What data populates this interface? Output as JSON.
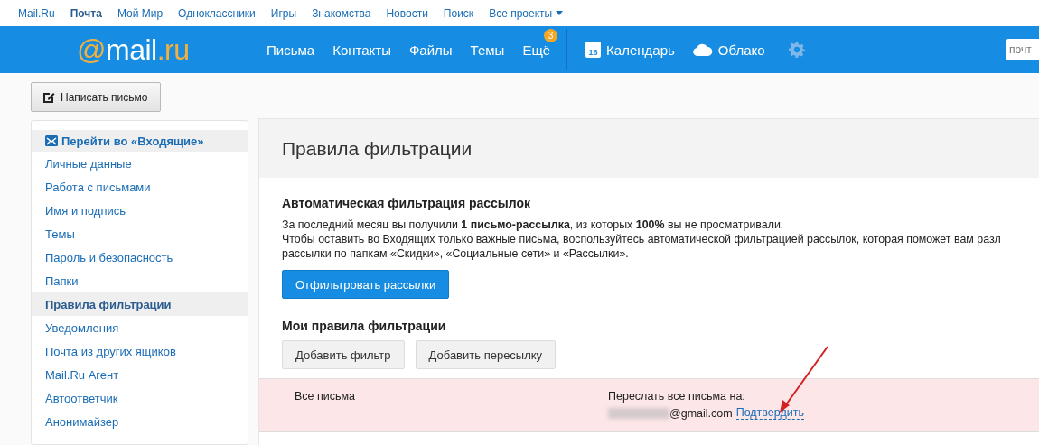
{
  "top_links": [
    {
      "label": "Mail.Ru",
      "selected": false
    },
    {
      "label": "Почта",
      "selected": true
    },
    {
      "label": "Мой Мир",
      "selected": false
    },
    {
      "label": "Одноклассники",
      "selected": false
    },
    {
      "label": "Игры",
      "selected": false
    },
    {
      "label": "Знакомства",
      "selected": false
    },
    {
      "label": "Новости",
      "selected": false
    },
    {
      "label": "Поиск",
      "selected": false
    },
    {
      "label": "Все проекты",
      "selected": false,
      "dropdown": true
    }
  ],
  "header": {
    "logo_at": "@",
    "logo_name": "mail",
    "logo_dot": ".",
    "logo_tld": "ru",
    "nav": [
      {
        "label": "Письма"
      },
      {
        "label": "Контакты"
      },
      {
        "label": "Файлы"
      },
      {
        "label": "Темы"
      },
      {
        "label": "Ещё",
        "badge": "3"
      }
    ],
    "apps": [
      {
        "kind": "calendar",
        "label": "Календарь",
        "icon_text": "16"
      },
      {
        "kind": "cloud",
        "label": "Облако"
      }
    ],
    "search": {
      "placeholder": "почт"
    }
  },
  "compose_button": "Написать письмо",
  "sidebar": {
    "items": [
      {
        "label": "Перейти во «Входящие»",
        "kind": "inbox",
        "selected": false
      },
      {
        "label": "Личные данные",
        "selected": false
      },
      {
        "label": "Работа с письмами",
        "selected": false
      },
      {
        "label": "Имя и подпись",
        "selected": false
      },
      {
        "label": "Темы",
        "selected": false
      },
      {
        "label": "Пароль и безопасность",
        "selected": false
      },
      {
        "label": "Папки",
        "selected": false
      },
      {
        "label": "Правила фильтрации",
        "selected": true
      },
      {
        "label": "Уведомления",
        "selected": false
      },
      {
        "label": "Почта из других ящиков",
        "selected": false
      },
      {
        "label": "Mail.Ru Агент",
        "selected": false
      },
      {
        "label": "Автоответчик",
        "selected": false
      },
      {
        "label": "Анонимайзер",
        "selected": false
      }
    ]
  },
  "content": {
    "title": "Правила фильтрации",
    "auto_filter": {
      "heading": "Автоматическая фильтрация рассылок",
      "lines": [
        "За последний месяц вы получили **1 письмо-рассылка**, из которых **100%** вы не просматривали.",
        "Чтобы оставить во Входящих только важные письма, воспользуйтесь автоматической фильтрацией рассылок, которая поможет вам разл",
        "рассылки по папкам «Скидки», «Социальные сети» и «Рассылки»."
      ],
      "button": "Отфильтровать рассылки"
    },
    "my_rules": {
      "heading": "Мои правила фильтрации",
      "buttons": [
        "Добавить фильтр",
        "Добавить пересылку"
      ],
      "rules": [
        {
          "condition": "Все письма",
          "action": "Переслать все письма на:",
          "address": "@gmail.com",
          "address_blurred": true,
          "confirm_link": "Подтвердить",
          "unconfirmed": true
        }
      ]
    }
  },
  "annotation": {
    "kind": "arrow"
  }
}
